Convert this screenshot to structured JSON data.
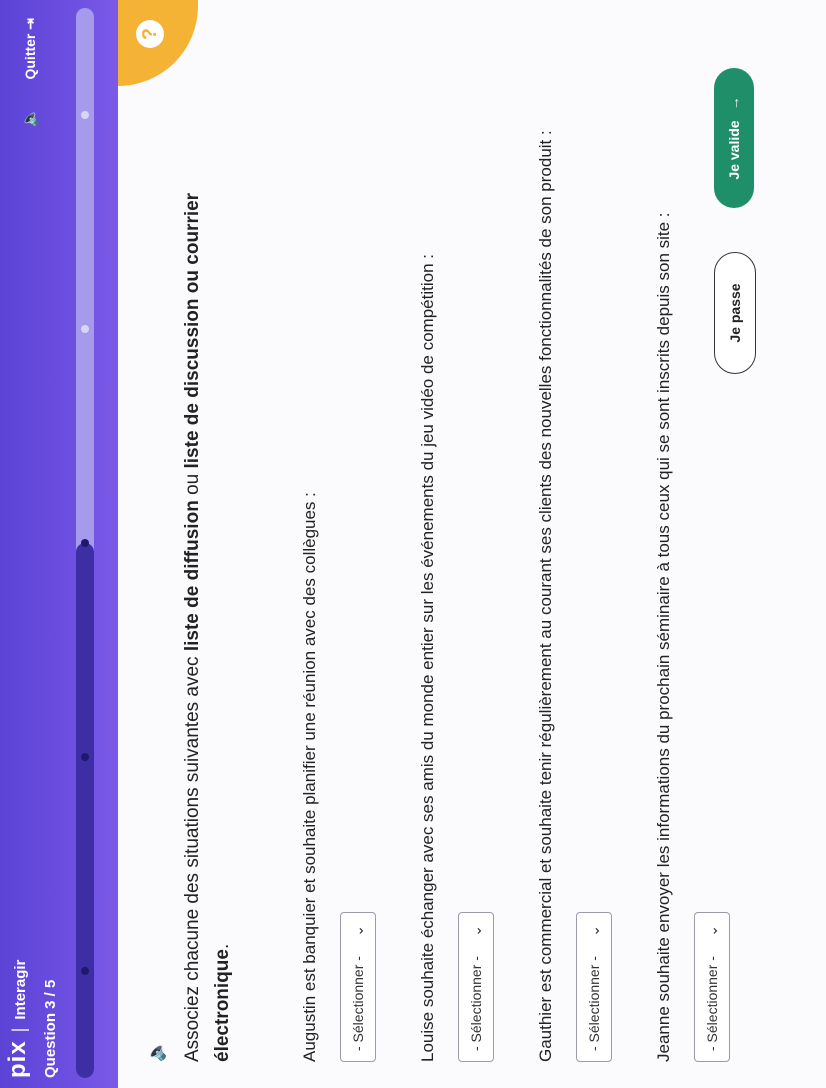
{
  "header": {
    "logo": "pix",
    "separator": "|",
    "app_name": "Interagir",
    "question_counter": "Question 3 / 5",
    "quit_label": "Quitter",
    "quit_icon": "exit-icon",
    "sound_icon": "speaker-icon",
    "progress": {
      "current": 3,
      "total": 5
    }
  },
  "help": {
    "label": "?"
  },
  "question": {
    "sound_icon": "speaker-icon",
    "instruction_prefix": "Associez chacune des situations suivantes avec ",
    "bold1": "liste de diffusion",
    "connector": " ou ",
    "bold2": "liste de discussion ou courrier électronique",
    "instruction_suffix": "."
  },
  "situations": [
    {
      "text": "Augustin est banquier et souhaite planifier une réunion avec des collègues :",
      "select_value": "- Sélectionner -"
    },
    {
      "text": "Louise souhaite échanger avec ses amis du monde entier sur les événements du jeu vidéo de compétition :",
      "select_value": "- Sélectionner -"
    },
    {
      "text": "Gauthier est commercial et souhaite tenir régulièrement au courant ses clients des nouvelles fonctionnalités de son produit :",
      "select_value": "- Sélectionner -"
    },
    {
      "text": "Jeanne souhaite envoyer les informations du prochain séminaire à tous ceux qui se sont inscrits depuis son site :",
      "select_value": "- Sélectionner -"
    }
  ],
  "actions": {
    "skip_label": "Je passe",
    "validate_label": "Je valide",
    "validate_icon": "arrow-right-icon"
  },
  "colors": {
    "header": "#6b4ee0",
    "help": "#f5b335",
    "validate": "#1f8f6a"
  }
}
